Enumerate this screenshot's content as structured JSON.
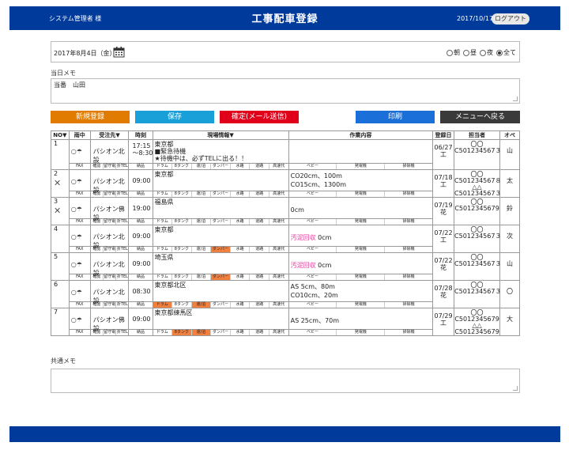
{
  "header": {
    "user": "システム管理者 様",
    "title": "工事配車登録",
    "date": "2017/10/17",
    "logout": "ログアウト"
  },
  "filter": {
    "date": "2017年8月4日（金）",
    "radios": [
      {
        "label": "朝",
        "checked": false
      },
      {
        "label": "昼",
        "checked": false
      },
      {
        "label": "夜",
        "checked": false
      },
      {
        "label": "全て",
        "checked": true
      }
    ]
  },
  "day_memo": {
    "label": "当日メモ",
    "value": "当番　山田"
  },
  "buttons": {
    "new": "新規登録",
    "save": "保存",
    "confirm": "確定(メール送信)",
    "print": "印刷",
    "menu": "メニューへ戻る"
  },
  "colors": {
    "new": "#e07b00",
    "save": "#1aa0d8",
    "confirm": "#e0001a",
    "print": "#1a6fd8",
    "menu": "#3a3a3a"
  },
  "table": {
    "headers": [
      "NO▼",
      "雨中",
      "受注先▼",
      "時刻",
      "現場情報▼",
      "作業内容",
      "登録日",
      "担当者",
      "オペ"
    ],
    "sub_client": [
      "確認",
      "留守電",
      "折TEL"
    ],
    "sub_time": "納品",
    "sub_site": [
      "ドラム",
      "8タンク",
      "運/泊",
      "ダンパー",
      "水路",
      "道路",
      "高速代"
    ],
    "sub_work": [
      "ベビー",
      "発電機",
      "掃除機"
    ],
    "fax": "FAX",
    "rows": [
      {
        "no": "1",
        "cancel": false,
        "client": "パシオン北設",
        "time": "17:15\n〜8:30",
        "site": "東京都\n■緊急待機\n★待機中は、必ずTELに出る！！",
        "work": [],
        "reg": "06/27\n工",
        "staff": "〇〇\nC501234567３",
        "op": "山",
        "hl": []
      },
      {
        "no": "2",
        "cancel": true,
        "client": "パシオン北設",
        "time": "09:00",
        "site": "東京都",
        "work": [
          "CO20cm、100m",
          "CO15cm、1300m"
        ],
        "reg": "07/18\n工",
        "staff": "〇〇\nC501234567８\n△△\nC501234567３",
        "op": "太",
        "hl": []
      },
      {
        "no": "3",
        "cancel": true,
        "client": "パシオン佛設",
        "time": "19:00",
        "site": "福島県",
        "work": [
          "0cm"
        ],
        "reg": "07/19\n花",
        "staff": "〇〇\nC5012345679",
        "op": "鈴",
        "hl": []
      },
      {
        "no": "4",
        "cancel": false,
        "client": "パシオン北設",
        "time": "09:00",
        "site": "東京都",
        "work": [
          "汚泥回収 0cm"
        ],
        "pink": true,
        "reg": "07/22\n工",
        "staff": "〇〇\nC501234567３",
        "op": "次",
        "hl": [
          3
        ]
      },
      {
        "no": "5",
        "cancel": false,
        "client": "パシオン北設",
        "time": "09:00",
        "site": "埼玉県",
        "work": [
          "汚泥回収 0cm"
        ],
        "pink": true,
        "reg": "07/22\n花",
        "staff": "〇〇\nC501234567３",
        "op": "山",
        "hl": [
          3
        ]
      },
      {
        "no": "6",
        "cancel": false,
        "client": "パシオン北設",
        "time": "08:30",
        "site": "東京都北区",
        "work": [
          "AS 5cm、80m",
          "CO10cm、20m"
        ],
        "reg": "07/28\n花",
        "staff": "〇〇\nC501234567３",
        "op": "〇",
        "hl": [
          0,
          2
        ]
      },
      {
        "no": "7",
        "cancel": false,
        "client": "パシオン佛設",
        "time": "09:00",
        "site": "東京都練馬区",
        "work": [
          "AS 25cm、70m"
        ],
        "reg": "07/29\n工",
        "staff": "〇〇\nC5012345679\n△△\nC5012345679",
        "op": "大",
        "hl": [
          1,
          2
        ]
      }
    ]
  },
  "common_memo": {
    "label": "共通メモ",
    "value": ""
  }
}
